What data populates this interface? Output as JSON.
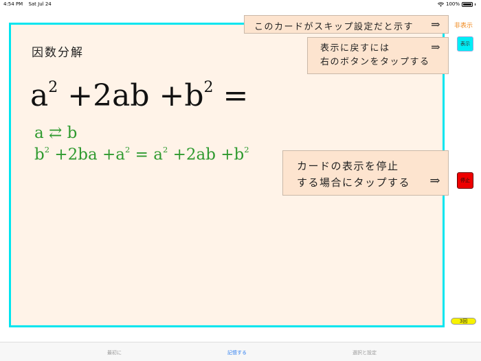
{
  "status_bar": {
    "time": "4:54 PM",
    "date": "Sat Jul 24",
    "battery": "100%"
  },
  "card": {
    "title": "因数分解",
    "formula_main": {
      "a": "a",
      "a_exp": "2",
      "mid": " +2ab +b",
      "b_exp": "2",
      "eq": " ="
    },
    "swap_line": "a ⇄ b",
    "expanded": {
      "b": "b",
      "b_exp": "2",
      "mid": " +2ba +a",
      "a_exp": "2",
      "eq": " = a",
      "a_exp2": "2",
      "mid2": " +2ab +b",
      "b_exp2": "2"
    }
  },
  "notes": {
    "skip": "このカードがスキップ設定だと示す",
    "restore_line1": "表示に戻すには",
    "restore_line2": "右のボタンをタップする",
    "stop_line1": "カードの表示を停止",
    "stop_line2": "する場合にタップする",
    "arrow": "⇒"
  },
  "side": {
    "hide_label": "非表示",
    "show_button": "表示",
    "stop_button": "停止",
    "count_badge": "3回"
  },
  "tabbar": {
    "tab1": "最初に",
    "tab2": "記憶する",
    "tab3": "選択と設定"
  },
  "colors": {
    "accent": "#2d7ef0",
    "card_border": "#00e5ef",
    "formula_green": "#2f9a2f",
    "stop": "#ee0000",
    "badge": "#f7f200"
  }
}
